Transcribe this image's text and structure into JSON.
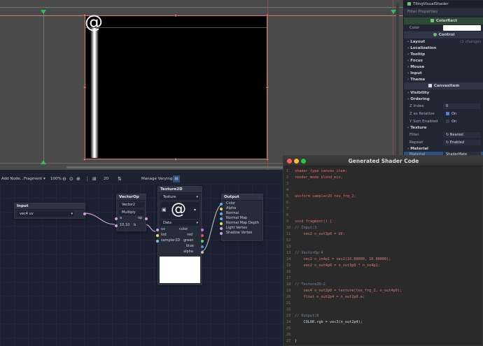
{
  "inspector": {
    "title": "TilingVisualShader",
    "filter_placeholder": "Filter Properties",
    "section_colorrect": "ColorRect",
    "color_label": "Color",
    "section_control": "Control",
    "categories": [
      "Layout",
      "Localization",
      "Tooltip",
      "Focus",
      "Mouse",
      "Input",
      "Theme"
    ],
    "layout_note": "(1 change)",
    "section_canvasitem": "CanvasItem",
    "visibility": "Visibility",
    "ordering": "Ordering",
    "z_index_label": "Z Index",
    "z_index_value": "0",
    "z_relative_label": "Z as Relative",
    "z_relative_value": "On",
    "ysort_label": "Y Sort Enabled",
    "ysort_value": "On",
    "texture": "Texture",
    "filter_label": "Filter",
    "filter_value": "Nearest",
    "repeat_label": "Repeat",
    "repeat_value": "Enabled",
    "material": "Material",
    "material_label": "Material",
    "material_value": "ShaderMate"
  },
  "toolbar": {
    "add_node": "Add Node...",
    "mode": "Fragment",
    "zoom": "100%",
    "snap": "20",
    "manage_varyings": "Manage Varyings"
  },
  "nodes": {
    "input": {
      "title": "Input",
      "value": "vec4 uv"
    },
    "vectorop": {
      "title": "VectorOp",
      "type": "Vector2",
      "op": "Multiply",
      "port_a": "a",
      "port_op": "op",
      "port_b": "b",
      "b_value": "10,10"
    },
    "texture": {
      "title": "Texture2D",
      "source": "Texture",
      "source2": "Data",
      "in_uv": "uv",
      "in_lod": "lod",
      "in_sampler": "sampler2D",
      "out_color": "color",
      "out_red": "red",
      "out_green": "green",
      "out_blue": "blue",
      "out_alpha": "alpha"
    },
    "output": {
      "title": "Output",
      "ports": [
        "Color",
        "Alpha",
        "Normal",
        "Normal Map",
        "Normal Map Depth",
        "Light Vertex",
        "Shadow Vertex"
      ]
    }
  },
  "shader_window": {
    "title": "Generated Shader Code",
    "lines": [
      {
        "n": "1",
        "t": "shader_type canvas_item;"
      },
      {
        "n": "2",
        "t": "render_mode blend_mix;"
      },
      {
        "n": "3",
        "t": ""
      },
      {
        "n": "4",
        "t": ""
      },
      {
        "n": "5",
        "t": "uniform sampler2D tex_frg_2;"
      },
      {
        "n": "6",
        "t": ""
      },
      {
        "n": "7",
        "t": ""
      },
      {
        "n": "8",
        "t": ""
      },
      {
        "n": "9",
        "t": "void fragment() {"
      },
      {
        "n": "10",
        "t": "// Input:3"
      },
      {
        "n": "11",
        "t": "    vec2 n_out3p0 = UV;"
      },
      {
        "n": "12",
        "t": ""
      },
      {
        "n": "13",
        "t": ""
      },
      {
        "n": "13",
        "t": "// VectorOp:4"
      },
      {
        "n": "14",
        "t": "    vec2 n_in4p1 = vec2(10.00000, 10.00000);"
      },
      {
        "n": "15",
        "t": "    vec2 n_out4p0 = n_out3p0 * n_in4p1;"
      },
      {
        "n": "16",
        "t": ""
      },
      {
        "n": "17",
        "t": ""
      },
      {
        "n": "18",
        "t": "// Texture2D:2"
      },
      {
        "n": "19",
        "t": "    vec4 n_out2p0 = texture(tex_frg_2, n_out4p0);"
      },
      {
        "n": "20",
        "t": "    float n_out2p4 = n_out2p0.a;"
      },
      {
        "n": "21",
        "t": ""
      },
      {
        "n": "22",
        "t": ""
      },
      {
        "n": "23",
        "t": "// Output:0"
      },
      {
        "n": "24",
        "t": "    COLOR.rgb = vec3(n_out2p4);"
      },
      {
        "n": "25",
        "t": ""
      },
      {
        "n": "26",
        "t": ""
      },
      {
        "n": "27",
        "t": "}"
      }
    ]
  },
  "viewport": {
    "at_symbol": "@"
  },
  "colors": {
    "accent": "#4a7fd8",
    "selection": "#d8806e",
    "guide": "#2fbf5a"
  }
}
